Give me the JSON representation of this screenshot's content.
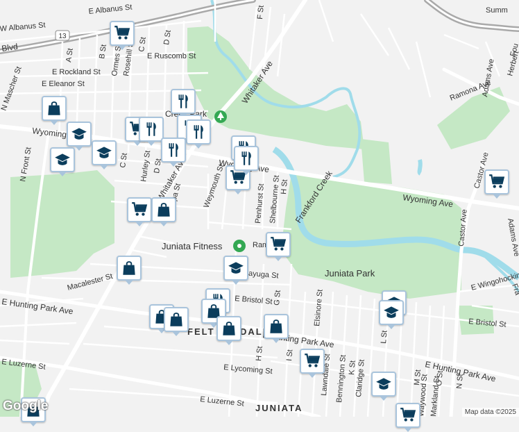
{
  "street_labels": {
    "albanus": "E Albanus St",
    "w_albanus": "W Albanus St",
    "route_13": "13",
    "blvd": "Blvd",
    "ruscomb": "E Ruscomb St",
    "rockland": "E Rockland St",
    "eleanor": "E Eleanor St",
    "mascher": "N Mascher St",
    "front": "N Front St",
    "wyoming_w": "Wyoming Ave",
    "wyoming_mid": "Wyoming Ave",
    "wyoming_e": "Wyoming Ave",
    "whitaker_n": "Whitaker Ave",
    "whitaker_s": "Whitaker Ave",
    "a_st": "A St",
    "b_st": "B St",
    "c_st_n": "C St",
    "c_st_s": "C St",
    "d_st_n": "D St",
    "d_st_s": "D St",
    "ormes": "Ormes St",
    "rosehill": "Rosehill St",
    "hurley": "Hurley St",
    "f_st": "F St",
    "weymouth": "Weymouth St",
    "penhurst": "Penhurst St",
    "shelbourne": "Shelbourne St",
    "h_st_n": "H St",
    "h_st_s": "H St",
    "ramona": "Ramona Ave",
    "adams_n": "Adams Ave",
    "adams_s": "Adams Ave",
    "castor_n": "Castor Ave",
    "castor_s": "Castor Ave",
    "herbert": "Herbert",
    "summ": "Summ",
    "fou": "Fou",
    "macalester": "Macalester St",
    "cayuga": "Cayuga St",
    "ramona_short": "Ram",
    "hunting_park_w": "E Hunting Park Ave",
    "hunting_park_c": "E Hunting Park Ave",
    "hunting_park_e": "E Hunting Park Ave",
    "bristol_w": "E Bristol St",
    "bristol_e": "E Bristol St",
    "luzerne_w": "E Luzerne St",
    "luzerne_c": "E Luzerne St",
    "lycoming": "E Lycoming St",
    "wingohocking": "E Wingohocking",
    "elsinore": "Elsinore St",
    "lawndale": "Lawndale St",
    "bennington": "Bennington St",
    "k_st": "K St",
    "claridge": "Claridge St",
    "l_st": "L St",
    "m_st": "M St",
    "i_st": "I St",
    "g_st": "G St",
    "waywood": "Waywood St",
    "markland": "Markland St",
    "o_st": "O St",
    "n_st": "N St",
    "tampa": "Tampa St",
    "fra": "Fra"
  },
  "place_labels": {
    "frankford_creek": "Frankford Creek",
    "juniata_park": "Juniata Park",
    "juniata_fitness": "Juniata Fitness",
    "felton": "FELT",
    "felton_end": "DALE",
    "juniata": "JUNIATA",
    "creek_park": "Creek Park"
  },
  "attribution": "Map data ©2025",
  "logo": "Google",
  "markers": [
    {
      "icon": "grocery-cart-icon",
      "label": "Grocery store"
    },
    {
      "icon": "grocery-cart-icon",
      "label": "Grocery store"
    },
    {
      "icon": "grocery-cart-icon",
      "label": "Grocery store"
    },
    {
      "icon": "grocery-cart-icon",
      "label": "Grocery store"
    },
    {
      "icon": "grocery-cart-icon",
      "label": "Grocery store"
    },
    {
      "icon": "grocery-cart-icon",
      "label": "Grocery store"
    },
    {
      "icon": "grocery-cart-icon",
      "label": "Grocery store"
    },
    {
      "icon": "grocery-cart-icon",
      "label": "Grocery store"
    },
    {
      "icon": "restaurant-icon",
      "label": "Restaurant"
    },
    {
      "icon": "restaurant-icon",
      "label": "Restaurant"
    },
    {
      "icon": "restaurant-icon",
      "label": "Restaurant"
    },
    {
      "icon": "restaurant-icon",
      "label": "Restaurant"
    },
    {
      "icon": "restaurant-icon",
      "label": "Restaurant"
    },
    {
      "icon": "restaurant-icon",
      "label": "Restaurant"
    },
    {
      "icon": "restaurant-icon",
      "label": "Restaurant"
    },
    {
      "icon": "restaurant-icon",
      "label": "Restaurant"
    },
    {
      "icon": "school-icon",
      "label": "School"
    },
    {
      "icon": "school-icon",
      "label": "School"
    },
    {
      "icon": "school-icon",
      "label": "School"
    },
    {
      "icon": "school-icon",
      "label": "School"
    },
    {
      "icon": "school-icon",
      "label": "School"
    },
    {
      "icon": "school-icon",
      "label": "School"
    },
    {
      "icon": "school-icon",
      "label": "School"
    },
    {
      "icon": "shopping-bag-icon",
      "label": "Store"
    },
    {
      "icon": "shopping-bag-icon",
      "label": "Store"
    },
    {
      "icon": "shopping-bag-icon",
      "label": "Store"
    },
    {
      "icon": "shopping-bag-icon",
      "label": "Store"
    },
    {
      "icon": "shopping-bag-icon",
      "label": "Store"
    },
    {
      "icon": "shopping-bag-icon",
      "label": "Store"
    },
    {
      "icon": "shopping-bag-icon",
      "label": "Store"
    },
    {
      "icon": "shopping-bag-icon",
      "label": "Store"
    },
    {
      "icon": "shopping-bag-icon",
      "label": "Store"
    },
    {
      "icon": "coffee-cup-icon",
      "label": "Cafe"
    },
    {
      "icon": "park-tree-icon",
      "label": "Park"
    },
    {
      "icon": "fitness-pin-icon",
      "label": "Fitness"
    }
  ],
  "colors": {
    "land": "#f2f2f2",
    "park": "#c5e8c5",
    "water": "#a0dcea",
    "highway": "#a9a9a9",
    "road": "#ffffff",
    "marker_border": "#a9c4dc",
    "marker_icon": "#0b3d5c"
  }
}
